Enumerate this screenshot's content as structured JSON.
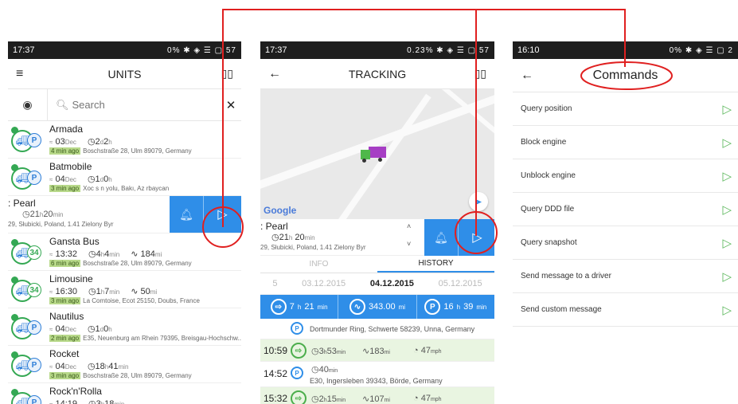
{
  "colors": {
    "accent": "#2f8ee8",
    "annotation": "#e02020",
    "moving": "#34a853"
  },
  "units": {
    "status": {
      "time": "17:37",
      "right": "0%  ✱  ◈  ☰  ▢  57"
    },
    "title": "UNITS",
    "menu_icon": "hamburger-icon",
    "map_icon": "map-icon",
    "search_placeholder": "Search",
    "items": [
      {
        "name": "Armada",
        "time": "03",
        "time_unit": "Dec",
        "dur": "2",
        "dur_unit": "d",
        "dur2": "2",
        "dur2_unit": "h",
        "ago": "4 min ago",
        "addr": "Boschstraße 28, Ulm 89079, Germany"
      },
      {
        "name": "Batmobile",
        "time": "04",
        "time_unit": "Dec",
        "dur": "1",
        "dur_unit": "d",
        "dur2": "0",
        "dur2_unit": "h",
        "ago": "3 min ago",
        "addr": "Xoc s n yolu, Bakı, Az rbaycan"
      },
      {
        "name": "Gansta Bus",
        "speed": "34",
        "time": "13:32",
        "dur": "4",
        "dur_unit": "h",
        "dur2": "4",
        "dur2_unit": "min",
        "dist": "184",
        "dist_unit": "mi",
        "ago": "6 min ago",
        "addr": "Boschstraße 28, Ulm 89079, Germany"
      },
      {
        "name": "Limousine",
        "speed": "34",
        "time": "16:30",
        "dur": "1",
        "dur_unit": "h",
        "dur2": "7",
        "dur2_unit": "min",
        "dist": "50",
        "dist_unit": "mi",
        "ago": "3 min ago",
        "addr": "La Comtoise, Ecot 25150, Doubs, France"
      },
      {
        "name": "Nautilus",
        "time": "04",
        "time_unit": "Dec",
        "dur": "1",
        "dur_unit": "d",
        "dur2": "0",
        "dur2_unit": "h",
        "ago": "2 min ago",
        "addr": "E35, Neuenburg am Rhein 79395, Breisgau-Hochschw.."
      },
      {
        "name": "Rocket",
        "time": "04",
        "time_unit": "Dec",
        "dur": "18",
        "dur_unit": "h",
        "dur2": "41",
        "dur2_unit": "min",
        "ago": "3 min ago",
        "addr": "Boschstraße 28, Ulm 89079, Germany"
      },
      {
        "name": "Rock'n'Rolla",
        "time": "14:19",
        "dur": "3",
        "dur_unit": "h",
        "dur2": "18",
        "dur2_unit": "min",
        "ago": "",
        "addr": ""
      }
    ],
    "swiped": {
      "name": ": Pearl",
      "dur": "21",
      "dur_unit": "h",
      "dur2": "20",
      "dur2_unit": "min",
      "addr": "29, Słubicki, Poland, 1.41  Zielony Byr"
    }
  },
  "tracking": {
    "status": {
      "time": "17:37",
      "right": "0.23%  ✱  ◈  ☰  ▢  57"
    },
    "title": "TRACKING",
    "map_brand": "Google",
    "unit": {
      "name": ": Pearl",
      "dur": "21",
      "dur_unit": "h",
      "dur2": "20",
      "dur2_unit": "min",
      "addr": "29, Słubicki, Poland, 1.41  Zielony Byr"
    },
    "tabs": [
      "INFO",
      "HISTORY"
    ],
    "dates": [
      "5",
      "03.12.2015",
      "04.12.2015",
      "05.12.2015"
    ],
    "summary": [
      {
        "val": "7",
        "u1": "h",
        "val2": "21",
        "u2": "min"
      },
      {
        "val": "343.00",
        "u1": "mi"
      },
      {
        "val": "16",
        "u1": "h",
        "val2": "39",
        "u2": "min"
      }
    ],
    "history": [
      {
        "type": "parking",
        "addr": "Dortmunder Ring, Schwerte 58239, Unna, Germany"
      },
      {
        "type": "trip",
        "time": "10:59",
        "dur": "3",
        "dur_u": "h",
        "dur2": "53",
        "dur2_u": "min",
        "dist": "183",
        "dist_u": "mi",
        "spd": "47",
        "spd_u": "mph"
      },
      {
        "type": "parking",
        "time": "14:52",
        "dur": "40",
        "dur_u": "min",
        "addr": "E30, Ingersleben 39343, Börde, Germany"
      },
      {
        "type": "trip",
        "time": "15:32",
        "dur": "2",
        "dur_u": "h",
        "dur2": "15",
        "dur2_u": "min",
        "dist": "107",
        "dist_u": "mi",
        "spd": "47",
        "spd_u": "mph"
      }
    ]
  },
  "commands": {
    "status": {
      "time": "16:10",
      "right": "0%  ✱  ◈  ☰  ▢  2"
    },
    "title": "Commands",
    "items": [
      "Query position",
      "Block engine",
      "Unblock engine",
      "Query DDD file",
      "Query snapshot",
      "Send message to a driver",
      "Send custom message"
    ]
  }
}
